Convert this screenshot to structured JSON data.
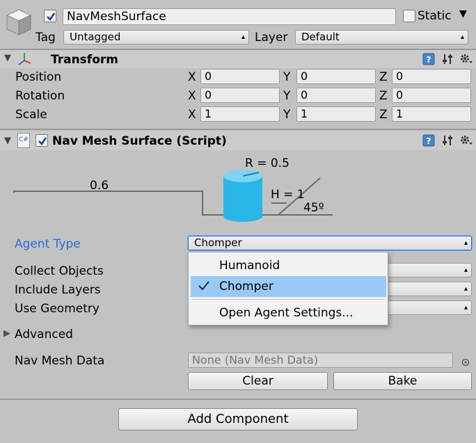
{
  "object": {
    "name": "NavMeshSurface",
    "active_checked": true,
    "static_label": "Static",
    "tag_label": "Tag",
    "tag_value": "Untagged",
    "layer_label": "Layer",
    "layer_value": "Default"
  },
  "transform": {
    "title": "Transform",
    "rows": [
      {
        "label": "Position",
        "x": "0",
        "y": "0",
        "z": "0"
      },
      {
        "label": "Rotation",
        "x": "0",
        "y": "0",
        "z": "0"
      },
      {
        "label": "Scale",
        "x": "1",
        "y": "1",
        "z": "1"
      }
    ],
    "axis_x": "X",
    "axis_y": "Y",
    "axis_z": "Z"
  },
  "navmesh": {
    "title": "Nav Mesh Surface (Script)",
    "enabled": true,
    "script_icon_text": "C#",
    "diagram": {
      "radius_label": "R = 0.5",
      "height_label": "H = 1",
      "step_label": "0.6",
      "slope_label": "45º"
    },
    "agent_type_label": "Agent Type",
    "agent_type_value": "Chomper",
    "collect_objects_label": "Collect Objects",
    "include_layers_label": "Include Layers",
    "use_geometry_label": "Use Geometry",
    "advanced_label": "Advanced",
    "nav_mesh_data_label": "Nav Mesh Data",
    "nav_mesh_data_value": "None (Nav Mesh Data)",
    "clear_label": "Clear",
    "bake_label": "Bake"
  },
  "dropdown_menu": {
    "items": [
      {
        "label": "Humanoid",
        "checked": false
      },
      {
        "label": "Chomper",
        "checked": true
      }
    ],
    "settings_label": "Open Agent Settings..."
  },
  "add_component_label": "Add Component",
  "colors": {
    "accent_blue": "#2b6ed6",
    "menu_highlight": "#99c9f5",
    "diagram_cyan": "#29b6e6"
  }
}
